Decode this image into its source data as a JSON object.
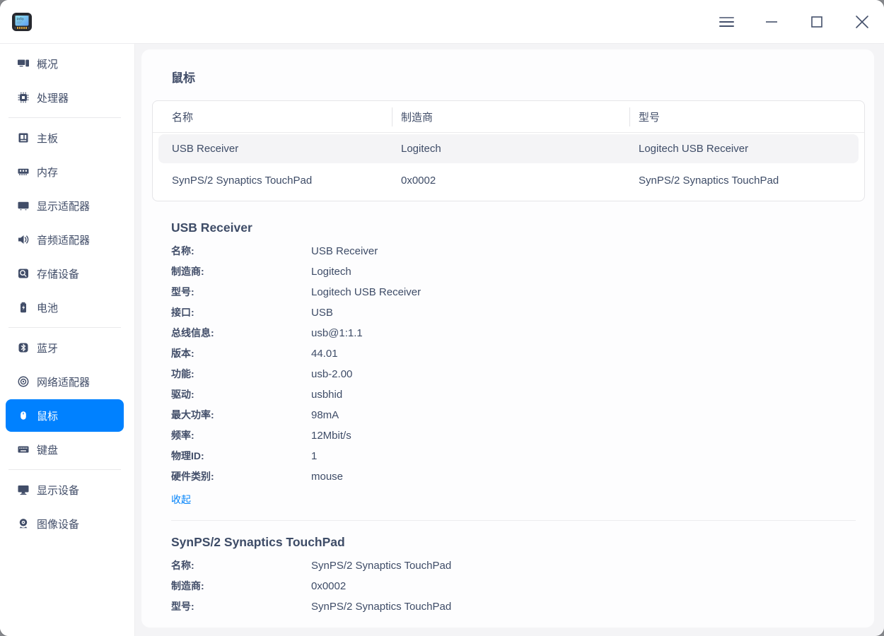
{
  "window": {
    "app_logo_text": "info",
    "controls": {
      "menu": "menu-icon",
      "minimize": "minimize-icon",
      "maximize": "maximize-icon",
      "close": "close-icon"
    }
  },
  "colors": {
    "accent": "#0081ff",
    "link": "#0082fa",
    "text": "#414d68",
    "selected_row_bg": "#f4f4f6"
  },
  "sidebar": {
    "groups": [
      {
        "items": [
          {
            "label": "概况",
            "icon": "overview-icon",
            "selected": false
          },
          {
            "label": "处理器",
            "icon": "processor-icon",
            "selected": false
          }
        ]
      },
      {
        "items": [
          {
            "label": "主板",
            "icon": "motherboard-icon",
            "selected": false
          },
          {
            "label": "内存",
            "icon": "memory-icon",
            "selected": false
          },
          {
            "label": "显示适配器",
            "icon": "display-adapter-icon",
            "selected": false
          },
          {
            "label": "音频适配器",
            "icon": "audio-adapter-icon",
            "selected": false
          },
          {
            "label": "存储设备",
            "icon": "storage-icon",
            "selected": false
          },
          {
            "label": "电池",
            "icon": "battery-icon",
            "selected": false
          }
        ]
      },
      {
        "items": [
          {
            "label": "蓝牙",
            "icon": "bluetooth-icon",
            "selected": false
          },
          {
            "label": "网络适配器",
            "icon": "network-adapter-icon",
            "selected": false
          },
          {
            "label": "鼠标",
            "icon": "mouse-icon",
            "selected": true
          },
          {
            "label": "键盘",
            "icon": "keyboard-icon",
            "selected": false
          }
        ]
      },
      {
        "items": [
          {
            "label": "显示设备",
            "icon": "display-device-icon",
            "selected": false
          },
          {
            "label": "图像设备",
            "icon": "image-device-icon",
            "selected": false
          }
        ]
      }
    ]
  },
  "main": {
    "title": "鼠标",
    "table": {
      "columns": [
        "名称",
        "制造商",
        "型号"
      ],
      "rows": [
        {
          "cells": [
            "USB Receiver",
            "Logitech",
            "Logitech USB Receiver"
          ],
          "selected": true
        },
        {
          "cells": [
            "SynPS/2 Synaptics TouchPad",
            "0x0002",
            "SynPS/2 Synaptics TouchPad"
          ],
          "selected": false
        }
      ]
    },
    "sections": [
      {
        "heading": "USB Receiver",
        "fields": [
          {
            "label": "名称:",
            "value": "USB Receiver"
          },
          {
            "label": "制造商:",
            "value": "Logitech"
          },
          {
            "label": "型号:",
            "value": "Logitech USB Receiver"
          },
          {
            "label": "接口:",
            "value": "USB"
          },
          {
            "label": "总线信息:",
            "value": "usb@1:1.1"
          },
          {
            "label": "版本:",
            "value": "44.01"
          },
          {
            "label": "功能:",
            "value": "usb-2.00"
          },
          {
            "label": "驱动:",
            "value": "usbhid"
          },
          {
            "label": "最大功率:",
            "value": "98mA"
          },
          {
            "label": "频率:",
            "value": "12Mbit/s"
          },
          {
            "label": "物理ID:",
            "value": "1"
          },
          {
            "label": "硬件类别:",
            "value": "mouse"
          }
        ],
        "collapse_link": "收起"
      },
      {
        "heading": "SynPS/2 Synaptics TouchPad",
        "fields": [
          {
            "label": "名称:",
            "value": "SynPS/2 Synaptics TouchPad"
          },
          {
            "label": "制造商:",
            "value": "0x0002"
          },
          {
            "label": "型号:",
            "value": "SynPS/2 Synaptics TouchPad"
          }
        ]
      }
    ]
  }
}
